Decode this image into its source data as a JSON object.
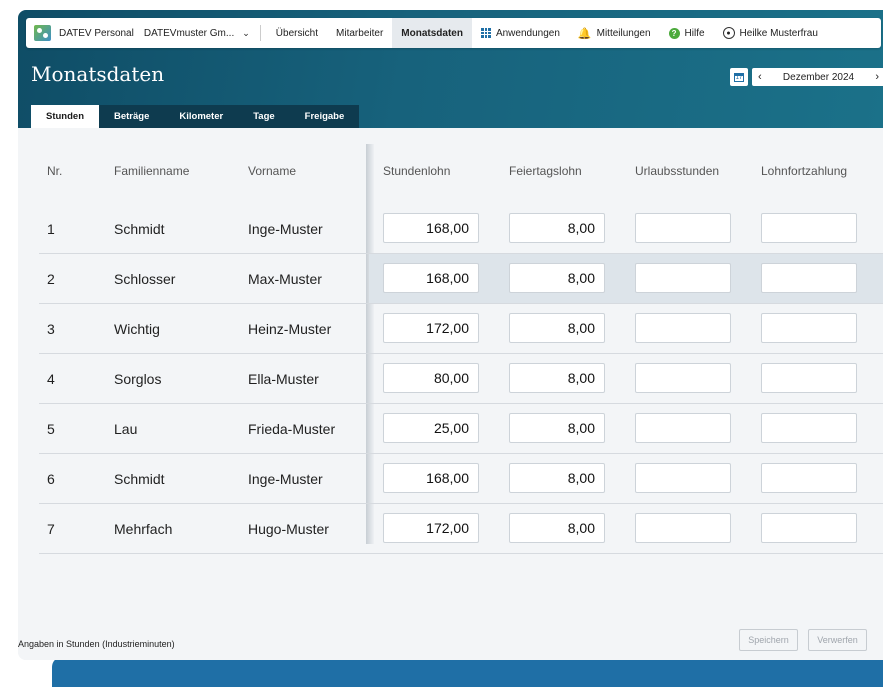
{
  "topnav": {
    "app_name": "DATEV Personal",
    "company": "DATEVmuster Gm...",
    "items": [
      "Übersicht",
      "Mitarbeiter",
      "Monatsdaten",
      "Anwendungen",
      "Mitteilungen",
      "Hilfe",
      "Heilke Musterfrau"
    ],
    "active": "Monatsdaten"
  },
  "page": {
    "title": "Monatsdaten",
    "calendar_icon_text": "17",
    "period": "Dezember 2024"
  },
  "tabs": [
    "Stunden",
    "Beträge",
    "Kilometer",
    "Tage",
    "Freigabe"
  ],
  "table": {
    "headers": [
      "Nr.",
      "Familienname",
      "Vorname",
      "Stundenlohn",
      "Feiertagslohn",
      "Urlaubsstunden",
      "Lohnfortzahlung"
    ],
    "rows": [
      {
        "nr": "1",
        "familienname": "Schmidt",
        "vorname": "Inge-Muster",
        "stundenlohn": "168,00",
        "feiertagslohn": "8,00",
        "urlaubsstunden": "",
        "lohnfortzahlung": ""
      },
      {
        "nr": "2",
        "familienname": "Schlosser",
        "vorname": "Max-Muster",
        "stundenlohn": "168,00",
        "feiertagslohn": "8,00",
        "urlaubsstunden": "",
        "lohnfortzahlung": ""
      },
      {
        "nr": "3",
        "familienname": "Wichtig",
        "vorname": "Heinz-Muster",
        "stundenlohn": "172,00",
        "feiertagslohn": "8,00",
        "urlaubsstunden": "",
        "lohnfortzahlung": ""
      },
      {
        "nr": "4",
        "familienname": "Sorglos",
        "vorname": "Ella-Muster",
        "stundenlohn": "80,00",
        "feiertagslohn": "8,00",
        "urlaubsstunden": "",
        "lohnfortzahlung": ""
      },
      {
        "nr": "5",
        "familienname": "Lau",
        "vorname": "Frieda-Muster",
        "stundenlohn": "25,00",
        "feiertagslohn": "8,00",
        "urlaubsstunden": "",
        "lohnfortzahlung": ""
      },
      {
        "nr": "6",
        "familienname": "Schmidt",
        "vorname": "Inge-Muster",
        "stundenlohn": "168,00",
        "feiertagslohn": "8,00",
        "urlaubsstunden": "",
        "lohnfortzahlung": ""
      },
      {
        "nr": "7",
        "familienname": "Mehrfach",
        "vorname": "Hugo-Muster",
        "stundenlohn": "172,00",
        "feiertagslohn": "8,00",
        "urlaubsstunden": "",
        "lohnfortzahlung": ""
      }
    ]
  },
  "footer": {
    "note": "Angaben in Stunden (Industrieminuten)",
    "save_label": "Speichern",
    "discard_label": "Verwerfen"
  }
}
